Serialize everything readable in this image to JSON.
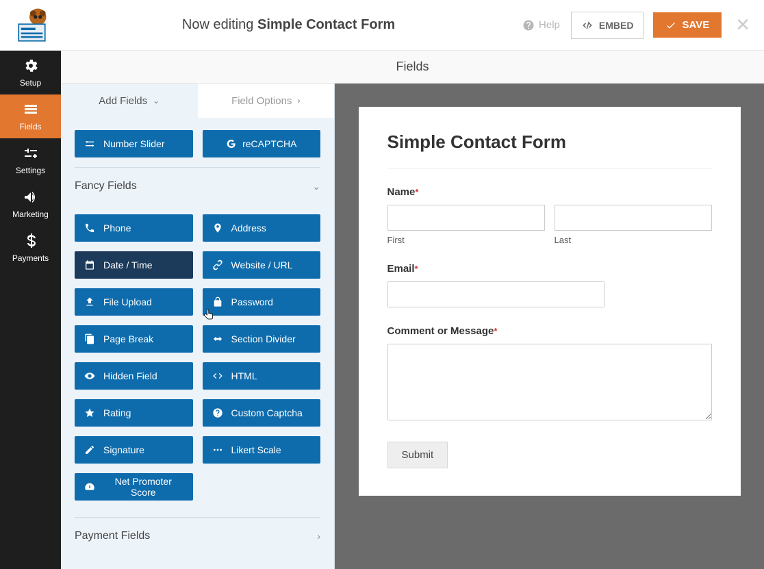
{
  "topbar": {
    "editing_prefix": "Now editing ",
    "form_name": "Simple Contact Form",
    "help": "Help",
    "embed": "EMBED",
    "save": "SAVE"
  },
  "nav": {
    "setup": "Setup",
    "fields": "Fields",
    "settings": "Settings",
    "marketing": "Marketing",
    "payments": "Payments"
  },
  "header": {
    "title": "Fields"
  },
  "tabs": {
    "add": "Add Fields",
    "options": "Field Options"
  },
  "fields": {
    "top": [
      {
        "label": "Number Slider",
        "icon": "slider"
      },
      {
        "label": "reCAPTCHA",
        "icon": "google"
      }
    ],
    "fancy_heading": "Fancy Fields",
    "fancy": [
      {
        "label": "Phone",
        "icon": "phone"
      },
      {
        "label": "Address",
        "icon": "pin"
      },
      {
        "label": "Date / Time",
        "icon": "calendar",
        "hover": true
      },
      {
        "label": "Website / URL",
        "icon": "link"
      },
      {
        "label": "File Upload",
        "icon": "upload"
      },
      {
        "label": "Password",
        "icon": "lock"
      },
      {
        "label": "Page Break",
        "icon": "copy"
      },
      {
        "label": "Section Divider",
        "icon": "arrows-h"
      },
      {
        "label": "Hidden Field",
        "icon": "eye"
      },
      {
        "label": "HTML",
        "icon": "code"
      },
      {
        "label": "Rating",
        "icon": "star"
      },
      {
        "label": "Custom Captcha",
        "icon": "question"
      },
      {
        "label": "Signature",
        "icon": "pencil"
      },
      {
        "label": "Likert Scale",
        "icon": "dots"
      },
      {
        "label": "Net Promoter Score",
        "icon": "gauge"
      }
    ],
    "payment_heading": "Payment Fields"
  },
  "preview": {
    "title": "Simple Contact Form",
    "name_label": "Name",
    "first": "First",
    "last": "Last",
    "email_label": "Email",
    "comment_label": "Comment or Message",
    "submit": "Submit"
  }
}
